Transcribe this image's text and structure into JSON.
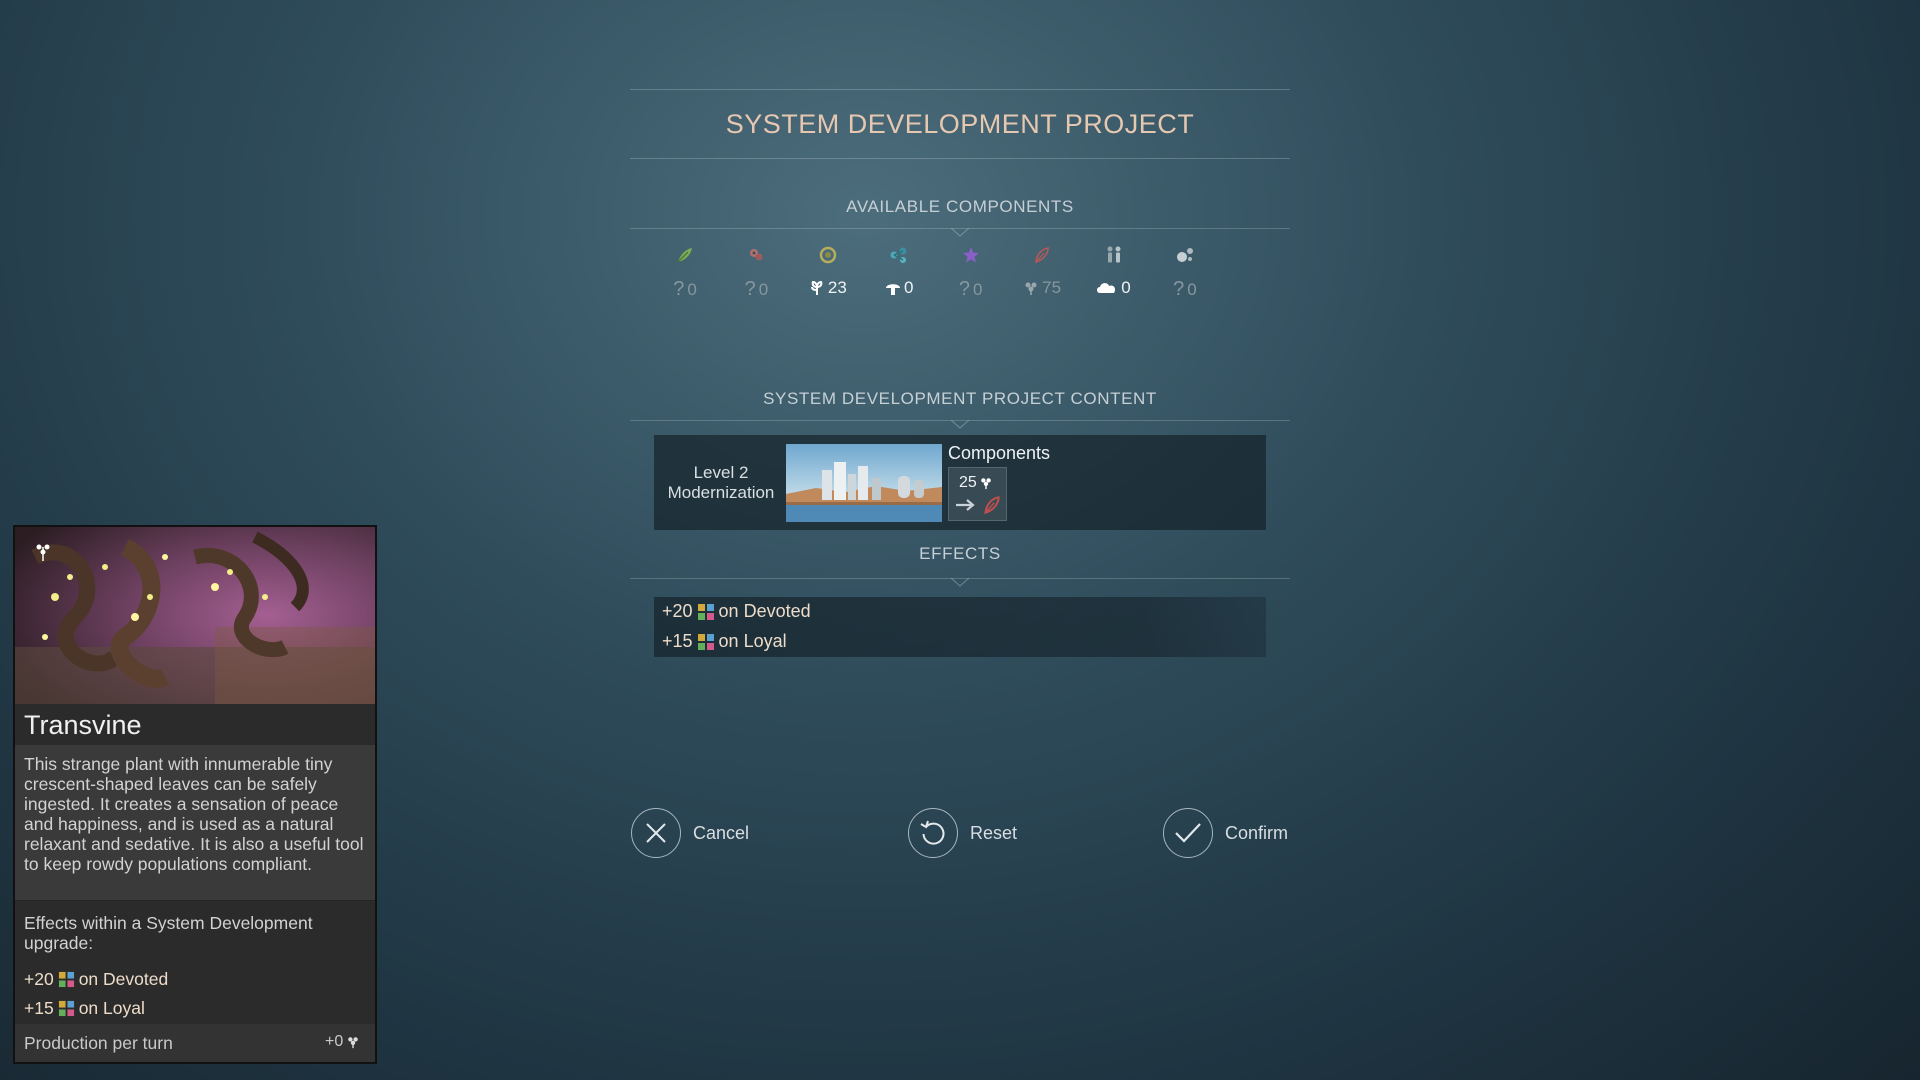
{
  "title": "SYSTEM DEVELOPMENT PROJECT",
  "available_components": {
    "heading": "AVAILABLE COMPONENTS",
    "items": [
      {
        "icon": "leaf-icon",
        "amount_icon": "unknown",
        "value": "0",
        "active": false
      },
      {
        "icon": "gear-cluster-icon",
        "amount_icon": "unknown",
        "value": "0",
        "active": false
      },
      {
        "icon": "ring-icon",
        "amount_icon": "plant-resource-icon",
        "value": "23",
        "active": true
      },
      {
        "icon": "molecule-icon",
        "amount_icon": "mushroom-resource-icon",
        "value": "0",
        "active": true
      },
      {
        "icon": "star-icon",
        "amount_icon": "unknown",
        "value": "0",
        "active": false
      },
      {
        "icon": "feather-icon",
        "amount_icon": "transvine-icon",
        "value": "75",
        "active": false
      },
      {
        "icon": "people-icon",
        "amount_icon": "cloud-icon",
        "value": "0",
        "active": true
      },
      {
        "icon": "flask-icon",
        "amount_icon": "unknown",
        "value": "0",
        "active": false
      }
    ],
    "unknown_symbol": "?"
  },
  "project_content": {
    "heading": "SYSTEM DEVELOPMENT PROJECT CONTENT",
    "level_line1": "Level 2",
    "level_line2": "Modernization",
    "components_label": "Components",
    "component_cost": "25"
  },
  "effects": {
    "heading": "EFFECTS",
    "lines": [
      {
        "value": "+20",
        "text": "on Devoted"
      },
      {
        "value": "+15",
        "text": "on Loyal"
      }
    ]
  },
  "buttons": {
    "cancel": "Cancel",
    "reset": "Reset",
    "confirm": "Confirm"
  },
  "card": {
    "name": "Transvine",
    "description": "This strange plant with innumerable tiny crescent-shaped leaves can be safely ingested. It creates a sensation of peace and happiness, and is used as a natural relaxant and sedative. It is also a useful tool to keep rowdy populations compliant.",
    "effects_title": "Effects within a System Development upgrade:",
    "effects": [
      {
        "value": "+20",
        "text": "on Devoted"
      },
      {
        "value": "+15",
        "text": "on Loyal"
      }
    ],
    "production_label": "Production per turn",
    "production_value": "+0"
  },
  "colors": {
    "title": "#e6c7b0",
    "effect_text": "#eddcc9",
    "accent_green": "#8bbf6a",
    "accent_purple": "#8a5fc8",
    "accent_red": "#c0504d"
  }
}
